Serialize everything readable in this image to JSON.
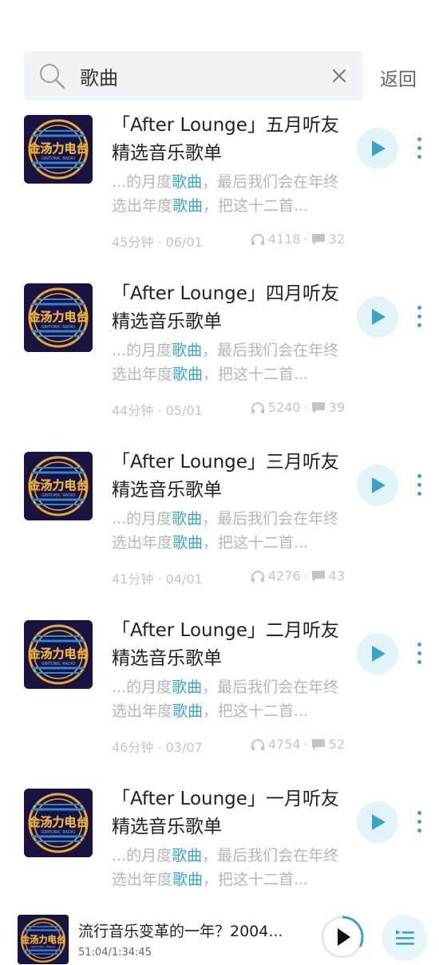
{
  "search": {
    "query": "歌曲",
    "back_label": "返回"
  },
  "results": [
    {
      "title": "「After Lounge」五月听友精选音乐歌单",
      "desc_pre": "...的月度",
      "desc_hl1": "歌曲",
      "desc_mid": "，最后我们会在年终选出年度",
      "desc_hl2": "歌曲",
      "desc_post": "，把这十二首...",
      "duration_date": "45分钟 · 06/01",
      "plays": "4118",
      "comments": "32"
    },
    {
      "title": "「After Lounge」四月听友精选音乐歌单",
      "desc_pre": "...的月度",
      "desc_hl1": "歌曲",
      "desc_mid": "，最后我们会在年终选出年度",
      "desc_hl2": "歌曲",
      "desc_post": "，把这十二首...",
      "duration_date": "44分钟 · 05/01",
      "plays": "5240",
      "comments": "39"
    },
    {
      "title": "「After Lounge」三月听友精选音乐歌单",
      "desc_pre": "...的月度",
      "desc_hl1": "歌曲",
      "desc_mid": "，最后我们会在年终选出年度",
      "desc_hl2": "歌曲",
      "desc_post": "，把这十二首...",
      "duration_date": "41分钟 · 04/01",
      "plays": "4276",
      "comments": "43"
    },
    {
      "title": "「After Lounge」二月听友精选音乐歌单",
      "desc_pre": "...的月度",
      "desc_hl1": "歌曲",
      "desc_mid": "，最后我们会在年终选出年度",
      "desc_hl2": "歌曲",
      "desc_post": "，把这十二首...",
      "duration_date": "46分钟 · 03/07",
      "plays": "4754",
      "comments": "52"
    },
    {
      "title": "「After Lounge」一月听友精选音乐歌单",
      "desc_pre": "...的月度",
      "desc_hl1": "歌曲",
      "desc_mid": "，最后我们会在年终选出年度",
      "desc_hl2": "歌曲",
      "desc_post": "，把这十二首...",
      "duration_date": "",
      "plays": "",
      "comments": ""
    }
  ],
  "cover_logo": {
    "line1": "金汤力电台",
    "line2": "GINTONIC RADIO"
  },
  "player": {
    "title": "流行音乐变革的一年？2004...",
    "time": "51:04/1:34:45"
  },
  "icons": {
    "search": "search-icon",
    "clear": "close-icon",
    "play": "play-icon",
    "more": "more-vertical-icon",
    "plays": "headphones-icon",
    "comments": "comment-icon",
    "playlist": "playlist-icon"
  },
  "colors": {
    "accent": "#3aa3c6",
    "accent_light": "#e3f4f9",
    "muted_text": "#b6b6b6",
    "search_bg": "#f2f3f5"
  }
}
